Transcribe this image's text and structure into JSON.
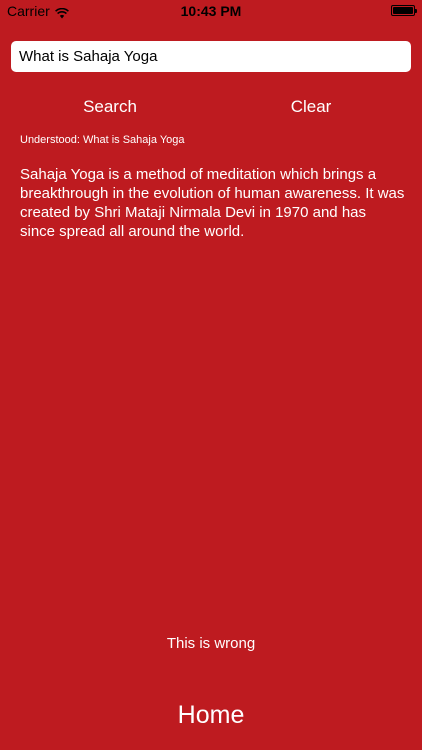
{
  "status_bar": {
    "carrier": "Carrier",
    "time": "10:43 PM"
  },
  "search": {
    "value": "What is Sahaja Yoga",
    "search_label": "Search",
    "clear_label": "Clear"
  },
  "result": {
    "understood": "Understood: What is Sahaja Yoga",
    "answer": "Sahaja Yoga is a method of meditation which brings a breakthrough in the evolution of human awareness. It was created by Shri Mataji Nirmala Devi in 1970 and has since spread all around the world."
  },
  "footer": {
    "wrong_label": "This is wrong",
    "home_label": "Home"
  },
  "colors": {
    "background": "#BE1B20",
    "text": "#FFFFFF"
  }
}
